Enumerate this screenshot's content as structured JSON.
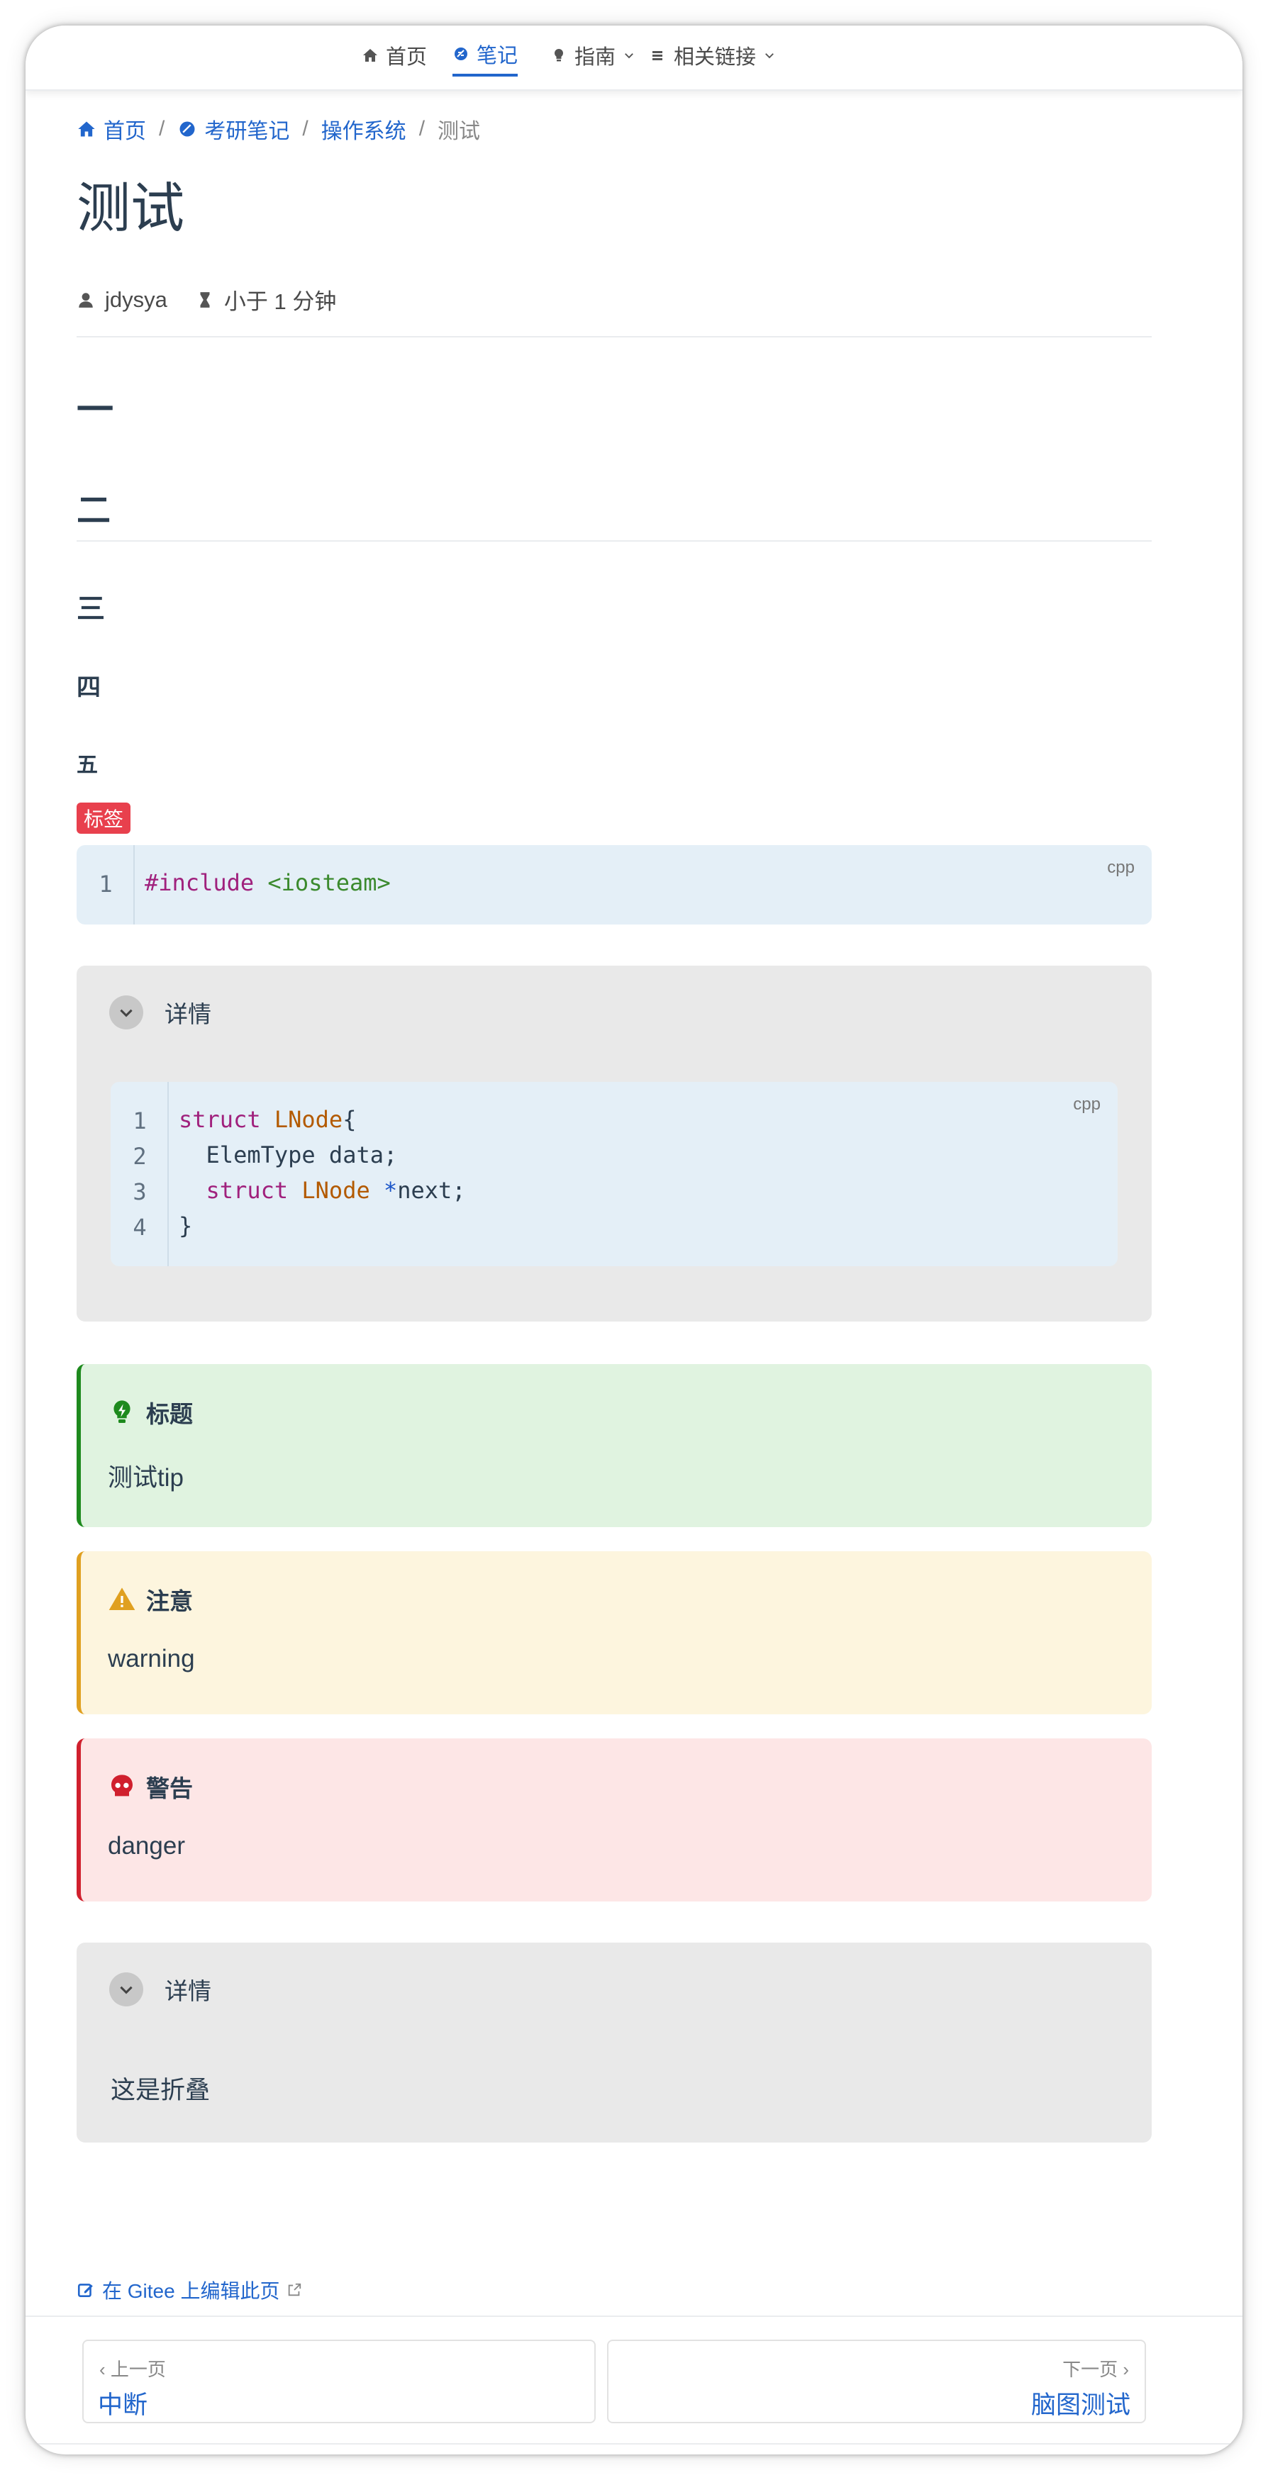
{
  "navbar": {
    "items": [
      {
        "label": "首页",
        "icon": "home-icon"
      },
      {
        "label": "笔记",
        "icon": "note-icon",
        "active": true
      },
      {
        "label": "指南",
        "icon": "bulb-icon",
        "dropdown": true
      },
      {
        "label": "相关链接",
        "icon": "stack-icon",
        "dropdown": true
      }
    ]
  },
  "breadcrumb": {
    "items": [
      "首页",
      "考研笔记",
      "操作系统"
    ],
    "current": "测试",
    "separator": "/"
  },
  "page": {
    "title": "测试",
    "author": "jdysya",
    "reading_time": "小于 1 分钟"
  },
  "headings": [
    "一",
    "二",
    "三",
    "四",
    "五"
  ],
  "tag": {
    "label": "标签"
  },
  "code_block_1": {
    "lang": "cpp",
    "line_numbers": [
      "1"
    ],
    "lines": [
      {
        "directive": "#include",
        "header": "<iosteam>"
      }
    ]
  },
  "details_1": {
    "summary": "详情",
    "code": {
      "lang": "cpp",
      "line_numbers": [
        "1",
        "2",
        "3",
        "4"
      ],
      "lines": [
        {
          "kw": "struct",
          "type": "LNode",
          "rest": "{"
        },
        {
          "indent": "  ",
          "text": "ElemType data;"
        },
        {
          "indent": "  ",
          "kw": "struct",
          "type": "LNode",
          "op": "*",
          "rest": "next;"
        },
        {
          "text": "}"
        }
      ]
    }
  },
  "callouts": [
    {
      "kind": "tip",
      "title": "标题",
      "body": "测试tip",
      "icon": "bulb-icon",
      "color": "#2e7d32",
      "bg": "#e0f3e0",
      "border": "#1e8a1e"
    },
    {
      "kind": "warning",
      "title": "注意",
      "body": "warning",
      "icon": "warning-icon",
      "color": "#333",
      "bg": "#fdf5de",
      "border": "#e0a020"
    },
    {
      "kind": "danger",
      "title": "警告",
      "body": "danger",
      "icon": "skull-icon",
      "color": "#333",
      "bg": "#fde6e6",
      "border": "#d0202e"
    }
  ],
  "details_2": {
    "summary": "详情",
    "body": "这是折叠"
  },
  "footer": {
    "edit_link": "在 Gitee 上编辑此页",
    "prev_label": "上一页",
    "prev_title": "中断",
    "next_label": "下一页",
    "next_title": "脑图测试"
  }
}
